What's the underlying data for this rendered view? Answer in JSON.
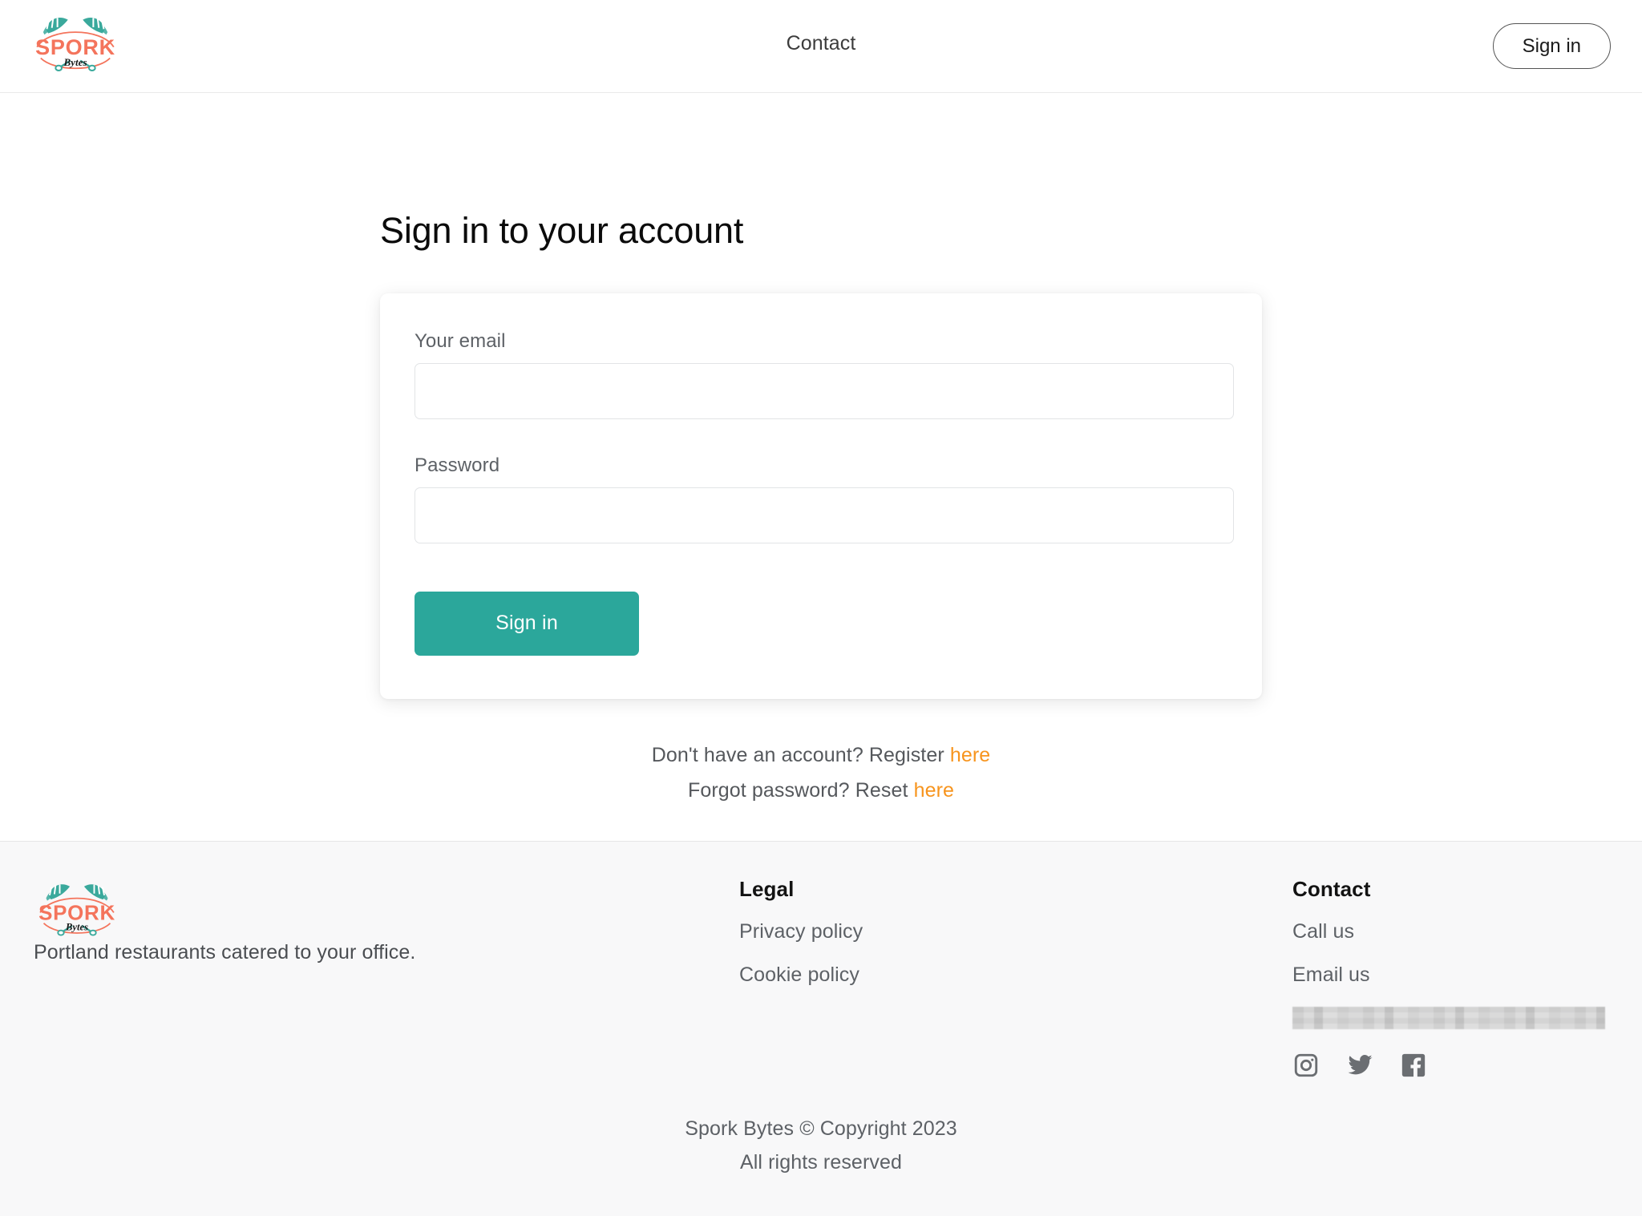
{
  "brand": {
    "name": "SPORK",
    "sub": "Bytes",
    "colors": {
      "orange": "#f4745c",
      "teal": "#3aa99c",
      "accent_link": "#f7941d",
      "button": "#2ba79b"
    }
  },
  "header": {
    "logo_icon": "spork-bytes-logo",
    "nav": [
      {
        "label": "Contact"
      }
    ],
    "signin_label": "Sign in"
  },
  "main": {
    "title": "Sign in to your account",
    "form": {
      "email_label": "Your email",
      "email_value": "",
      "email_placeholder": "",
      "password_label": "Password",
      "password_value": "",
      "password_placeholder": "",
      "submit_label": "Sign in"
    },
    "helpers": {
      "register_text": "Don't have an account? Register ",
      "register_link": "here",
      "reset_text": "Forgot password? Reset ",
      "reset_link": "here"
    }
  },
  "footer": {
    "logo_icon": "spork-bytes-logo",
    "tagline": "Portland restaurants catered to your office.",
    "legal": {
      "heading": "Legal",
      "links": [
        {
          "label": "Privacy policy"
        },
        {
          "label": "Cookie policy"
        }
      ]
    },
    "contact": {
      "heading": "Contact",
      "links": [
        {
          "label": "Call us"
        },
        {
          "label": "Email us"
        }
      ],
      "redacted_value": "",
      "socials": [
        {
          "icon": "instagram-icon"
        },
        {
          "icon": "twitter-icon"
        },
        {
          "icon": "facebook-icon"
        }
      ]
    },
    "copyright": "Spork Bytes © Copyright 2023",
    "rights": "All rights reserved"
  }
}
